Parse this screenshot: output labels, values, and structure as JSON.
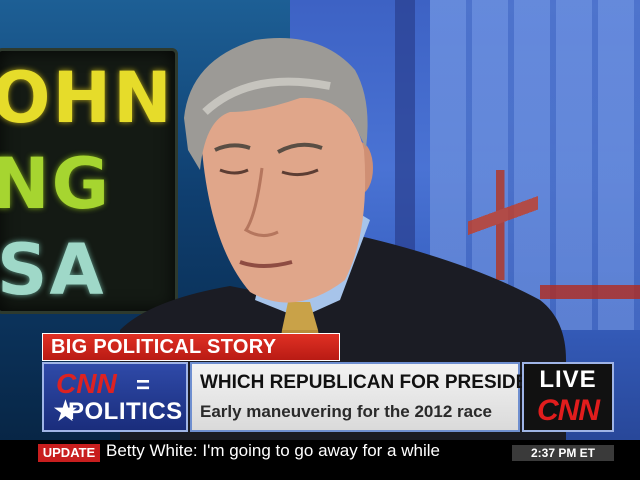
{
  "background_sign": {
    "line1": "OHN",
    "line2": "NG",
    "line3": "SA"
  },
  "lower_third": {
    "kicker": "BIG POLITICAL STORY",
    "logo": {
      "brand": "CNN",
      "equals": "=",
      "section": "POLITICS"
    },
    "headline": "WHICH REPUBLICAN FOR PRESIDENT?",
    "subheadline": "Early maneuvering for the 2012 race",
    "live_label": "LIVE",
    "network": "CNN"
  },
  "ticker": {
    "badge": "UPDATE",
    "text": "Betty White: I'm going to go away for a while",
    "clock": "2:37 PM ET"
  },
  "colors": {
    "kicker_red": "#d0261c",
    "logo_blue": "#24399a",
    "cnn_red": "#e11d1d"
  }
}
